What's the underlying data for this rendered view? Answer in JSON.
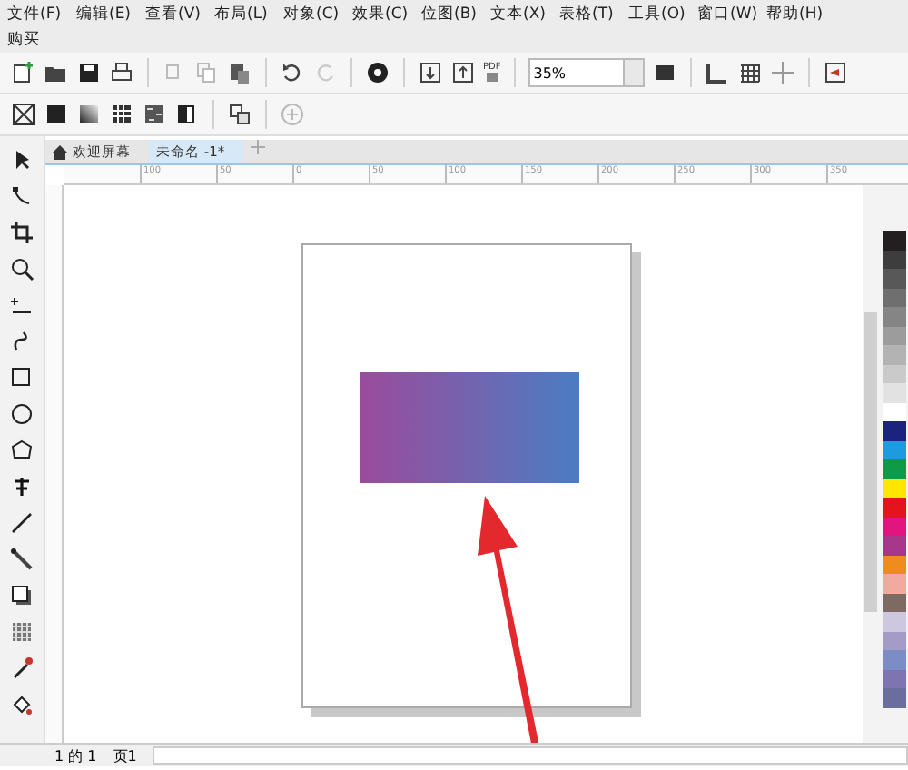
{
  "menu_bar": {
    "items": [
      "文件(F)",
      "编辑(E)",
      "查看(V)",
      "布局(L)",
      "对象(C)",
      "效果(C)",
      "位图(B)",
      "文本(X)",
      "表格(T)",
      "工具(O)",
      "窗口(W)",
      "帮助(H)",
      "购买"
    ]
  },
  "standard_toolbar": {
    "pdf_label": "PDF",
    "zoom": {
      "value": "35%"
    }
  },
  "document_tabs": [
    {
      "label": "欢迎屏幕",
      "selected": false,
      "kind": "home"
    },
    {
      "label": "未命名 -1*",
      "selected": true,
      "kind": "doc"
    }
  ],
  "ruler": {
    "labels": [
      "100",
      "50",
      "0",
      "50",
      "100",
      "150",
      "200",
      "250",
      "300",
      "350"
    ]
  },
  "palette": {
    "colors": [
      {
        "color": "#231f20"
      },
      {
        "color": "#3d3d3d"
      },
      {
        "color": "#585858"
      },
      {
        "color": "#6f6f6f"
      },
      {
        "color": "#858585"
      },
      {
        "color": "#9c9c9c"
      },
      {
        "color": "#b3b3b3"
      },
      {
        "color": "#cacaca"
      },
      {
        "color": "#e2e2e2"
      },
      {
        "color": "#ffffff"
      },
      {
        "color": "#1a237e"
      },
      {
        "color": "#1e9be0"
      },
      {
        "color": "#0f9a48"
      },
      {
        "color": "#ffe600"
      },
      {
        "color": "#e3141c"
      },
      {
        "color": "#e2157e"
      },
      {
        "color": "#a8368a"
      },
      {
        "color": "#f08b1d"
      },
      {
        "color": "#f2aaa0"
      },
      {
        "color": "#7d6a63"
      },
      {
        "color": "#cdc7e0"
      },
      {
        "color": "#a49bc6"
      },
      {
        "color": "#7c8cc4"
      },
      {
        "color": "#7f74b2"
      },
      {
        "color": "#6a6e9e"
      }
    ]
  },
  "status_bar": {
    "page_count": "1 的 1",
    "page_tab": "页1"
  }
}
